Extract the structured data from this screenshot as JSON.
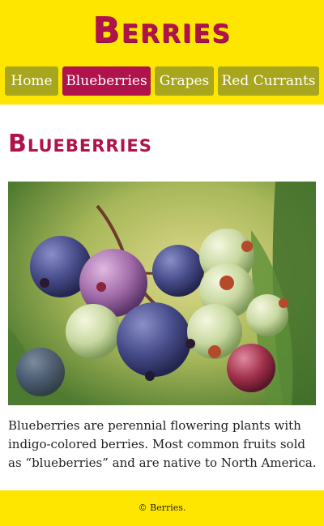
{
  "site": {
    "title": "Berries",
    "brand_color": "#b0124c",
    "accent_color": "#ffe600",
    "nav_color": "#a7a61d"
  },
  "nav": {
    "items": [
      {
        "label": "Home",
        "active": false
      },
      {
        "label": "Blueberries",
        "active": true
      },
      {
        "label": "Grapes",
        "active": false
      },
      {
        "label": "Red Currants",
        "active": false
      }
    ]
  },
  "main": {
    "heading": "Blueberries",
    "description": "Blueberries are perennial flowering plants with indigo-colored berries. Most common fruits sold as “blueberries” and are native to North America."
  },
  "footer": {
    "copyright": "© Berries."
  }
}
